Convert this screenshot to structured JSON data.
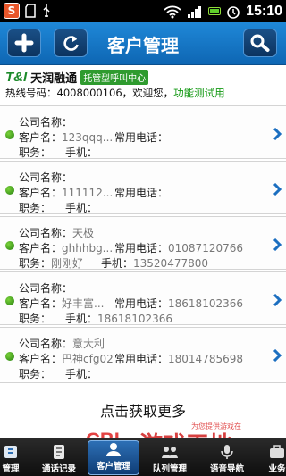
{
  "status_bar": {
    "time": "15:10",
    "app_letter": "S"
  },
  "header": {
    "title": "客户管理",
    "add_icon": "plus-icon",
    "refresh_icon": "refresh-icon",
    "search_icon": "search-icon"
  },
  "brand": {
    "logo": "T&I",
    "name": "天润融通",
    "tag": "托管型呼叫中心",
    "hotline_prefix": "热线号码：4008000106，欢迎您，",
    "hotline_link": "功能测试用"
  },
  "labels": {
    "company": "公司名称：",
    "customer": "客户名：",
    "phone": "常用电话：",
    "position": "职务：",
    "mobile": "手机："
  },
  "customers": [
    {
      "company": "",
      "name": "123qqq...",
      "phone": "",
      "position": "",
      "mobile": ""
    },
    {
      "company": "",
      "name": "111112...",
      "phone": "",
      "position": "",
      "mobile": ""
    },
    {
      "company": "天极",
      "name": "ghhhbg...",
      "phone": "01087120766",
      "position": "刚刚好",
      "mobile": "13520477800"
    },
    {
      "company": "",
      "name": "好丰富...",
      "phone": "18618102366",
      "position": "",
      "mobile": "18618102366"
    },
    {
      "company": "意大利",
      "name": "巴神cfg02",
      "phone": "18014785698",
      "position": "",
      "mobile": ""
    }
  ],
  "load_more": "点击获取更多",
  "watermark": {
    "cbi": "CBI",
    "big": "游戏天地",
    "small": "为您提供游戏在",
    "url": "www.CbiGame.com"
  },
  "tabs": [
    {
      "label": "管理",
      "icon": "contacts-icon",
      "active": false
    },
    {
      "label": "通话记录",
      "icon": "call-log-icon",
      "active": false
    },
    {
      "label": "客户管理",
      "icon": "customer-icon",
      "active": true
    },
    {
      "label": "队列管理",
      "icon": "queue-icon",
      "active": false
    },
    {
      "label": "语音导航",
      "icon": "voice-nav-icon",
      "active": false
    },
    {
      "label": "业务",
      "icon": "business-icon",
      "active": false
    }
  ],
  "colors": {
    "title_bar": "#1577c6",
    "accent_green": "#169a16",
    "active_tab": "#2d6fb5"
  }
}
